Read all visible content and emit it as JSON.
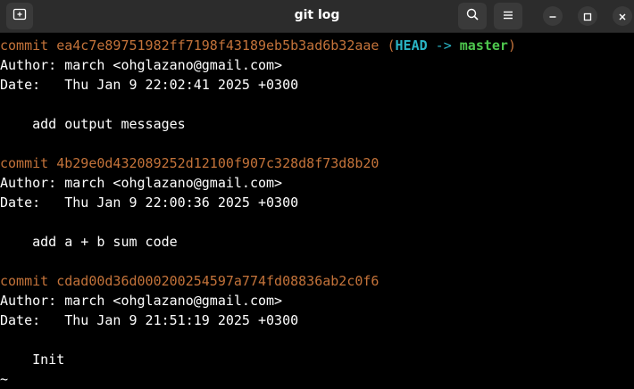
{
  "window": {
    "title": "git log"
  },
  "toolbar": {
    "icons": [
      "new-tab-icon",
      "search-icon",
      "menu-icon",
      "minimize-icon",
      "maximize-icon",
      "close-icon"
    ]
  },
  "terminal": {
    "commits": [
      {
        "commit_label": "commit",
        "hash": "ea4c7e89751982ff7198f43189eb5b3ad6b32aae",
        "refs_open": "(",
        "head": "HEAD",
        "arrow": "->",
        "branch": "master",
        "refs_close": ")",
        "author_line": "Author: march <ohglazano@gmail.com>",
        "date_line": "Date:   Thu Jan 9 22:02:41 2025 +0300",
        "message": "    add output messages"
      },
      {
        "commit_label": "commit",
        "hash": "4b29e0d432089252d12100f907c328d8f73d8b20",
        "author_line": "Author: march <ohglazano@gmail.com>",
        "date_line": "Date:   Thu Jan 9 22:00:36 2025 +0300",
        "message": "    add a + b sum code"
      },
      {
        "commit_label": "commit",
        "hash": "cdad00d36d000200254597a774fd08836ab2c0f6",
        "author_line": "Author: march <ohglazano@gmail.com>",
        "date_line": "Date:   Thu Jan 9 21:51:19 2025 +0300",
        "message": "    Init"
      }
    ],
    "pager_prompt": "~",
    "colors": {
      "hash": "#c4733a",
      "head": "#2ab5c5",
      "branch": "#4ec84e",
      "text": "#ffffff",
      "background": "#000000"
    }
  }
}
